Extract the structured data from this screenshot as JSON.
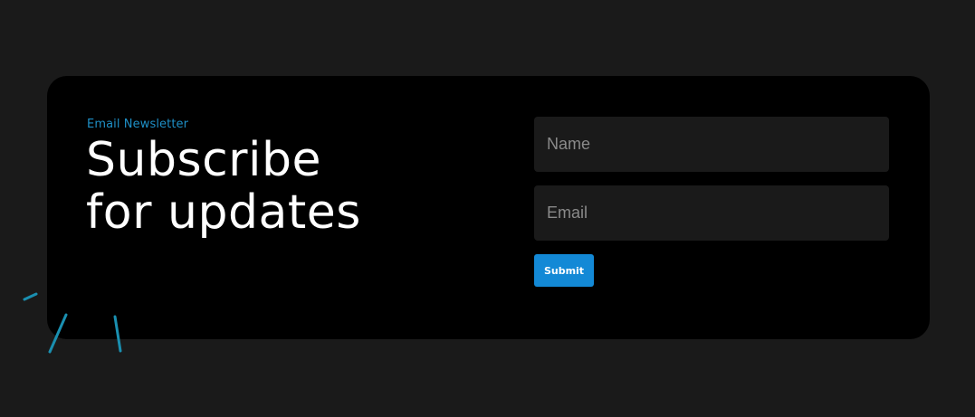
{
  "newsletter": {
    "eyebrow": "Email Newsletter",
    "headline_line1": "Subscribe",
    "headline_line2": "for updates"
  },
  "form": {
    "name_placeholder": "Name",
    "email_placeholder": "Email",
    "submit_label": "Submit"
  },
  "colors": {
    "page_background": "#1a1a1a",
    "card_background": "#000000",
    "accent": "#1e8fc6",
    "button": "#1389d6",
    "decoration": "#1a8fb0"
  },
  "icons": {
    "decoration": "sparkle-dashes"
  }
}
